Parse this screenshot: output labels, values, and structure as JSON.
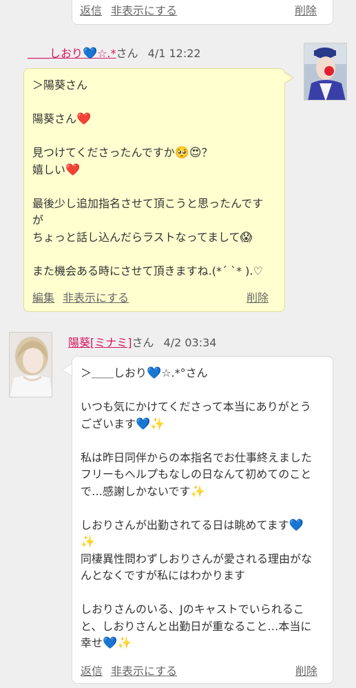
{
  "top_card": {
    "reply": "返信",
    "hide": "非表示にする",
    "delete": "削除"
  },
  "post1": {
    "author": "＿＿しおり💙☆.*",
    "honorific": "さん",
    "timestamp": "4/1 12:22",
    "lines": [
      "＞陽葵さん",
      "",
      "陽葵さん❤️",
      "",
      "見つけてくださったんですか🥺😍？",
      "嬉しい❤️",
      "",
      "最後少し追加指名させて頂こうと思ったんです",
      "が",
      "ちょっと話し込んだらラストなってまして😱",
      "",
      "また機会ある時にさせて頂きますね.(*ˊ ˋ* ).♡"
    ],
    "edit": "編集",
    "hide": "非表示にする",
    "delete": "削除"
  },
  "post2": {
    "author": "陽葵[ミナミ]",
    "honorific": "さん",
    "timestamp": "4/2 03:34",
    "lines": [
      "＞＿＿しおり💙☆.*°さん",
      "",
      "いつも気にかけてくださって本当にありがとう",
      "ございます💙✨",
      "",
      "私は昨日同伴からの本指名でお仕事終えました",
      "フリーもヘルプもなしの日なんて初めてのこと",
      "で…感謝しかないです✨",
      "",
      "しおりさんが出勤されてる日は眺めてます💙",
      "✨",
      "同棲異性問わずしおりさんが愛される理由がな",
      "んとなくですが私にはわかります",
      "",
      "しおりさんのいる、Jのキャストでいられるこ",
      "と、しおりさんと出勤日が重なること…本当に",
      "幸せ💙✨"
    ],
    "reply": "返信",
    "hide": "非表示にする",
    "delete": "削除"
  },
  "colors": {
    "name_link": "#d6145e",
    "bubble_yellow": "#ffffd0",
    "bubble_white": "#ffffff",
    "background": "#efefef"
  }
}
